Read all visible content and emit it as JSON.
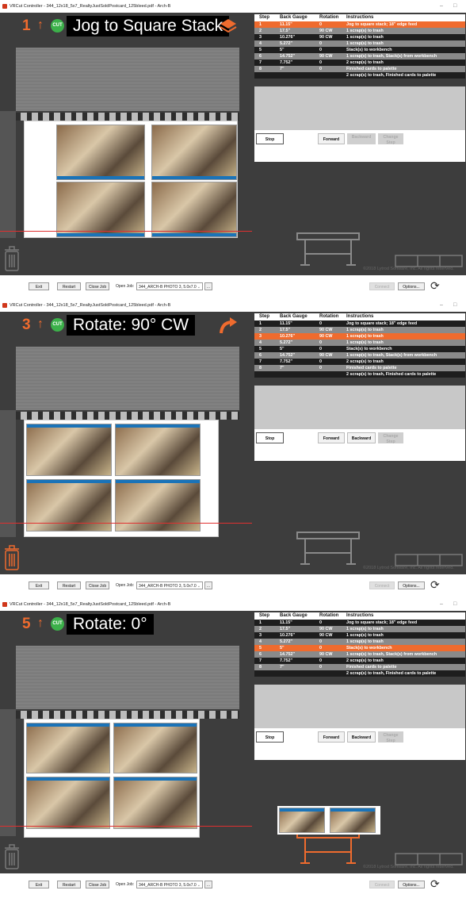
{
  "window": {
    "title": "VRCut Controller - 344_12x18_5x7_RealtyJustSoldPostcard_125bleed.pdf - Arch-B",
    "minimize": "–",
    "maximize": "□"
  },
  "colors": {
    "accent": "#ef6b2e",
    "cut_badge": "#3cb04a",
    "panel": "#3d3d3d",
    "highlight": "#ef6b2e"
  },
  "icons": [
    "stack-icon",
    "rotate-arrow-icon",
    "trash-icon",
    "workbench-icon",
    "palette-icon",
    "refresh-icon"
  ],
  "table": {
    "headers": {
      "step": "Step",
      "back_gauge": "Back Gauge",
      "rotation": "Rotation",
      "instructions": "Instructions"
    },
    "rows": [
      {
        "step": "1",
        "gauge": "11.15\"",
        "rotation": "0",
        "instruction": "Jog to square stack; 18\" edge feed"
      },
      {
        "step": "2",
        "gauge": "17.5\"",
        "rotation": "90 CW",
        "instruction": "1 scrap(s) to trash"
      },
      {
        "step": "3",
        "gauge": "10.276\"",
        "rotation": "90 CW",
        "instruction": "1 scrap(s) to trash"
      },
      {
        "step": "4",
        "gauge": "5.272\"",
        "rotation": "0",
        "instruction": "1 scrap(s) to trash"
      },
      {
        "step": "5",
        "gauge": "5\"",
        "rotation": "0",
        "instruction": "Stack(s) to workbench"
      },
      {
        "step": "6",
        "gauge": "14.752\"",
        "rotation": "90 CW",
        "instruction": "1 scrap(s) to trash, Stack(s) from workbench"
      },
      {
        "step": "7",
        "gauge": "7.752\"",
        "rotation": "0",
        "instruction": "2 scrap(s) to trash"
      },
      {
        "step": "8",
        "gauge": "7\"",
        "rotation": "0",
        "instruction": "Finished cards to palette"
      },
      {
        "step": "",
        "gauge": "",
        "rotation": "",
        "instruction": "2 scrap(s) to trash, Finished cards to palette"
      }
    ]
  },
  "controls": {
    "stop": "Stop",
    "forward": "Forward",
    "backward": "Backward",
    "change_step": "Change Step"
  },
  "copyright": "©2018 Lytrod Software, Inc. All rights reserved.",
  "bottom": {
    "exit": "Exit",
    "restart": "Restart",
    "close_job": "Close Job",
    "open_job_label": "Open Job:",
    "open_job_value": "344_ARCH-B PHOTO 3, 5.0x7.0",
    "browse": "...",
    "connect": "Connect",
    "options": "Options..."
  },
  "panels": [
    {
      "step_number": "1",
      "cut_badge": "CUT",
      "instruction_title": "Jog to Square Stack",
      "current_row": 1
    },
    {
      "step_number": "3",
      "cut_badge": "CUT",
      "instruction_title": "Rotate: 90° CW",
      "current_row": 3
    },
    {
      "step_number": "5",
      "cut_badge": "CUT",
      "instruction_title": "Rotate: 0°",
      "current_row": 5
    }
  ]
}
